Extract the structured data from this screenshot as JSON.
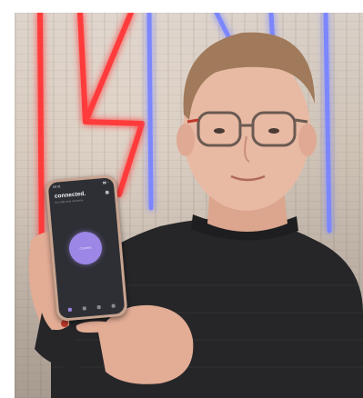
{
  "scene": {
    "colors": {
      "neon_red": "#ff3b3b",
      "neon_blue": "#6a78ff",
      "sweater": "#262628",
      "skin": "#e8b9a3",
      "hair": "#a07a5a",
      "phone_accent": "#9c86e6"
    }
  },
  "phone": {
    "status_time": "09:41",
    "status_icons": "▮▮ ◔",
    "app_title": "connected.",
    "app_subtitle": "fun calls near someone",
    "button_label": "Connect",
    "tabs": [
      {
        "icon": "home-icon",
        "active": true
      },
      {
        "icon": "chat-icon",
        "active": false
      },
      {
        "icon": "people-icon",
        "active": false
      },
      {
        "icon": "settings-icon",
        "active": false
      }
    ]
  }
}
